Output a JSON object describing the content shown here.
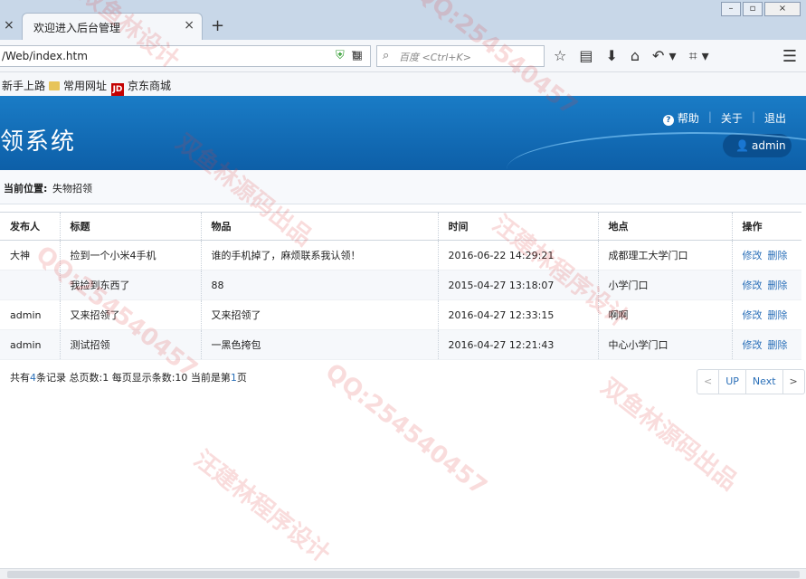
{
  "browser": {
    "tab_title": "欢迎进入后台管理",
    "url": "/Web/index.htm",
    "search_placeholder": "百度 <Ctrl+K>",
    "bookmarks": [
      "新手上路",
      "常用网址",
      "京东商城"
    ]
  },
  "header": {
    "title": "领系统",
    "links": [
      "帮助",
      "关于",
      "退出"
    ],
    "user": "admin"
  },
  "breadcrumb": {
    "label": "当前位置:",
    "value": "失物招领"
  },
  "table": {
    "columns": [
      "发布人",
      "标题",
      "物品",
      "时间",
      "地点",
      "操作"
    ],
    "rows": [
      {
        "publisher": "大神",
        "title": "捡到一个小米4手机",
        "item": "谁的手机掉了，麻烦联系我认领！",
        "time": "2016-06-22 14:29:21",
        "place": "成都理工大学门口"
      },
      {
        "publisher": "",
        "title": "我捡到东西了",
        "item": "88",
        "time": "2015-04-27 13:18:07",
        "place": "小学门口"
      },
      {
        "publisher": "admin",
        "title": "又来招领了",
        "item": "又来招领了",
        "time": "2016-04-27 12:33:15",
        "place": "啊啊"
      },
      {
        "publisher": "admin",
        "title": "测试招领",
        "item": "一黑色挎包",
        "time": "2016-04-27 12:21:43",
        "place": "中心小学门口"
      }
    ],
    "actions": [
      "修改",
      "删除"
    ]
  },
  "footer": {
    "p1": "共有",
    "total": "4",
    "p2": "条记录 总页数:1 每页显示条数:10 当前是第",
    "current": "1",
    "p3": "页"
  },
  "pager": {
    "prev_symbol": "<",
    "up": "UP",
    "next": "Next",
    "next_symbol": ">"
  },
  "watermark": [
    "双鱼林设计",
    "QQ:254540457",
    "双鱼林源码出品",
    "汪建林程序设计"
  ]
}
